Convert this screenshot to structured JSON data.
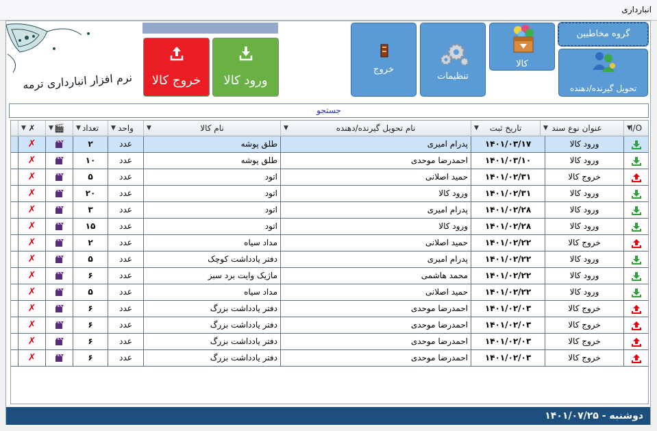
{
  "window": {
    "title": "انبارداری"
  },
  "logo": {
    "text": "نرم افزار انبارداری ترمه"
  },
  "buttons": {
    "goods_out": "خروج کالا",
    "goods_in": "ورود کالا",
    "exit": "خروج",
    "settings": "تنظیمات",
    "goods": "کالا",
    "contact_groups": "گروه مخاطبین",
    "receivers": "تحویل گیرنده/دهنده"
  },
  "search": {
    "label": "جستجو"
  },
  "table": {
    "headers": {
      "io": "I/O",
      "doc_type": "عنوان نوع سند",
      "date": "تاریخ ثبت",
      "person": "نام تحویل گیرنده/دهنده",
      "goods": "نام کالا",
      "unit": "واحد",
      "qty": "تعداد"
    },
    "rows": [
      {
        "io": "in",
        "doc_type": "ورود کالا",
        "date": "۱۴۰۱/۰۳/۱۷",
        "person": "پدرام امیری",
        "goods": "طلق پوشه",
        "unit": "عدد",
        "qty": "۲"
      },
      {
        "io": "in",
        "doc_type": "ورود کالا",
        "date": "۱۴۰۱/۰۳/۱۰",
        "person": "احمدرضا موحدی",
        "goods": "طلق پوشه",
        "unit": "عدد",
        "qty": "۱۰"
      },
      {
        "io": "out",
        "doc_type": "خروج کالا",
        "date": "۱۴۰۱/۰۲/۳۱",
        "person": "حمید اصلانی",
        "goods": "اتود",
        "unit": "عدد",
        "qty": "۵"
      },
      {
        "io": "in",
        "doc_type": "ورود کالا",
        "date": "۱۴۰۱/۰۲/۳۱",
        "person": "ورود کالا",
        "goods": "اتود",
        "unit": "عدد",
        "qty": "۲۰"
      },
      {
        "io": "in",
        "doc_type": "ورود کالا",
        "date": "۱۴۰۱/۰۲/۲۸",
        "person": "پدرام امیری",
        "goods": "اتود",
        "unit": "عدد",
        "qty": "۳"
      },
      {
        "io": "in",
        "doc_type": "ورود کالا",
        "date": "۱۴۰۱/۰۲/۲۸",
        "person": "ورود کالا",
        "goods": "اتود",
        "unit": "عدد",
        "qty": "۱۵"
      },
      {
        "io": "out",
        "doc_type": "خروج کالا",
        "date": "۱۴۰۱/۰۲/۲۲",
        "person": "حمید اصلانی",
        "goods": "مداد سیاه",
        "unit": "عدد",
        "qty": "۲"
      },
      {
        "io": "in",
        "doc_type": "ورود کالا",
        "date": "۱۴۰۱/۰۲/۲۲",
        "person": "پدرام امیری",
        "goods": "دفتر یادداشت کوچک",
        "unit": "عدد",
        "qty": "۵"
      },
      {
        "io": "in",
        "doc_type": "ورود کالا",
        "date": "۱۴۰۱/۰۲/۲۲",
        "person": "محمد هاشمی",
        "goods": "ماژیک وایت برد سبز",
        "unit": "عدد",
        "qty": "۶"
      },
      {
        "io": "in",
        "doc_type": "ورود کالا",
        "date": "۱۴۰۱/۰۲/۲۲",
        "person": "حمید اصلانی",
        "goods": "مداد سیاه",
        "unit": "عدد",
        "qty": "۵"
      },
      {
        "io": "out",
        "doc_type": "خروج کالا",
        "date": "۱۴۰۱/۰۲/۰۳",
        "person": "احمدرضا موحدی",
        "goods": "دفتر یادداشت بزرگ",
        "unit": "عدد",
        "qty": "۶"
      },
      {
        "io": "out",
        "doc_type": "خروج کالا",
        "date": "۱۴۰۱/۰۲/۰۳",
        "person": "احمدرضا موحدی",
        "goods": "دفتر یادداشت بزرگ",
        "unit": "عدد",
        "qty": "۶"
      },
      {
        "io": "out",
        "doc_type": "خروج کالا",
        "date": "۱۴۰۱/۰۲/۰۳",
        "person": "احمدرضا موحدی",
        "goods": "دفتر یادداشت بزرگ",
        "unit": "عدد",
        "qty": "۶"
      },
      {
        "io": "out",
        "doc_type": "خروج کالا",
        "date": "۱۴۰۱/۰۲/۰۳",
        "person": "احمدرضا موحدی",
        "goods": "دفتر یادداشت بزرگ",
        "unit": "عدد",
        "qty": "۶"
      }
    ],
    "selected_row": 0,
    "delete_glyph": "✗"
  },
  "status": {
    "text": "دوشنبه - ۱۴۰۱/۰۷/۲۵"
  },
  "colors": {
    "in_icon": "#2e9e3a",
    "out_icon": "#e10010",
    "tile": "#5b9bd5",
    "status_bar": "#1d4f7e"
  }
}
